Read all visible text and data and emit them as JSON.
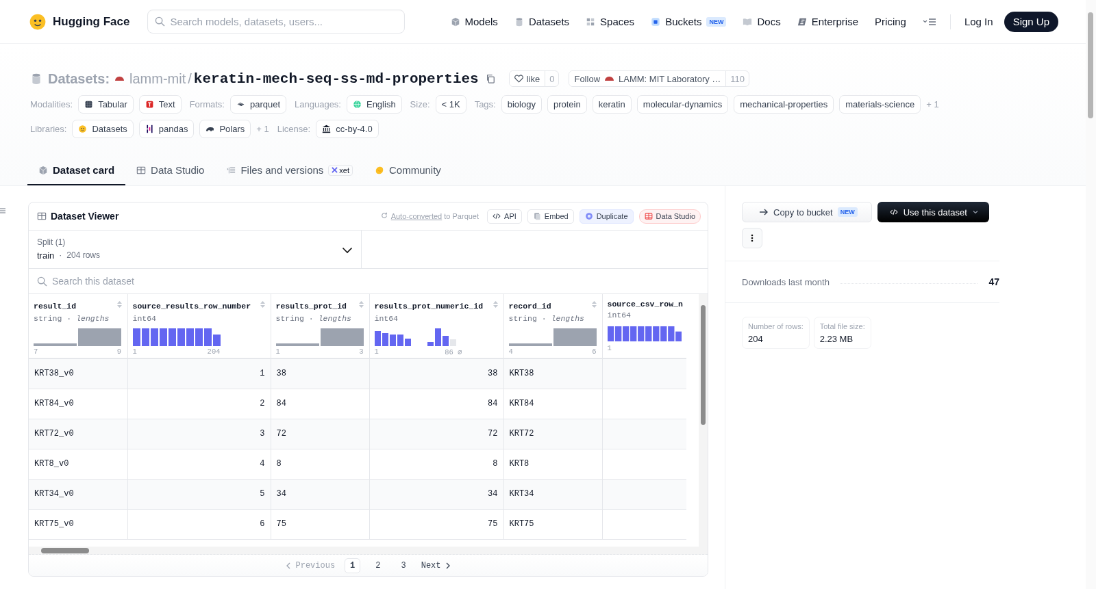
{
  "header": {
    "logo_text": "Hugging Face",
    "search": {
      "placeholder": "Search models, datasets, users..."
    },
    "nav": [
      {
        "label": "Models"
      },
      {
        "label": "Datasets"
      },
      {
        "label": "Spaces"
      },
      {
        "label": "Buckets",
        "badge": "NEW"
      },
      {
        "label": "Docs"
      },
      {
        "label": "Enterprise"
      },
      {
        "label": "Pricing"
      }
    ],
    "login": "Log In",
    "signup": "Sign Up"
  },
  "repo": {
    "type_label": "Datasets:",
    "owner": "lamm-mit",
    "separator": "/",
    "name": "keratin-mech-seq-ss-md-properties",
    "like": {
      "label": "like",
      "count": "0"
    },
    "follow": {
      "label": "Follow",
      "org": "LAMM: MIT Laboratory …",
      "count": "110"
    }
  },
  "meta_rows": [
    [
      {
        "label": "Modalities:",
        "chips": [
          "Tabular",
          "Text"
        ]
      },
      {
        "label": "Formats:",
        "chips": [
          "parquet"
        ]
      },
      {
        "label": "Languages:",
        "chips": [
          "English"
        ]
      },
      {
        "label": "Size:",
        "chips": [
          "< 1K"
        ]
      },
      {
        "label": "Tags:",
        "chips": [
          "biology",
          "protein",
          "keratin",
          "molecular-dynamics",
          "mechanical-properties",
          "materials-science"
        ],
        "more": "+ 1"
      }
    ],
    [
      {
        "label": "Libraries:",
        "chips": [
          "Datasets",
          "pandas",
          "Polars"
        ],
        "more": "+ 1"
      },
      {
        "label": "License:",
        "chips": [
          "cc-by-4.0"
        ]
      }
    ]
  ],
  "tabs": [
    {
      "label": "Dataset card",
      "selected": true
    },
    {
      "label": "Data Studio",
      "selected": false
    },
    {
      "label": "Files and versions",
      "selected": false,
      "badge": "xet"
    },
    {
      "label": "Community",
      "selected": false
    }
  ],
  "viewer": {
    "title": "Dataset Viewer",
    "converted_link": "Auto-converted",
    "converted_rest": "to Parquet",
    "actions": [
      {
        "label": "API",
        "kind": "code"
      },
      {
        "label": "Embed",
        "kind": "embed"
      },
      {
        "label": "Duplicate",
        "kind": "duplicate"
      },
      {
        "label": "Data Studio",
        "kind": "studio"
      }
    ],
    "split": {
      "label": "Split (1)",
      "name": "train",
      "dot": "·",
      "rows": "204 rows"
    },
    "search": {
      "placeholder": "Search this dataset"
    },
    "columns": [
      {
        "name": "result_id",
        "type": "string · *lengths*",
        "kind": "lengths",
        "min": "7",
        "max": "9"
      },
      {
        "name": "source_results_row_number",
        "type": "int64",
        "kind": "uniform",
        "min": "1",
        "max": "204"
      },
      {
        "name": "results_prot_id",
        "type": "string · *lengths*",
        "kind": "lengths",
        "min": "1",
        "max": "3"
      },
      {
        "name": "results_prot_numeric_id",
        "type": "int64",
        "kind": "bimodal",
        "min": "1",
        "max": "86 ∅"
      },
      {
        "name": "record_id",
        "type": "string · *lengths*",
        "kind": "lengths",
        "min": "4",
        "max": "6"
      },
      {
        "name": "source_csv_row_n",
        "type": "int64",
        "kind": "uniform",
        "min": "1"
      }
    ],
    "rows": [
      [
        "KRT38_v0",
        "1",
        "38",
        "38",
        "KRT38"
      ],
      [
        "KRT84_v0",
        "2",
        "84",
        "84",
        "KRT84"
      ],
      [
        "KRT72_v0",
        "3",
        "72",
        "72",
        "KRT72"
      ],
      [
        "KRT8_v0",
        "4",
        "8",
        "8",
        "KRT8"
      ],
      [
        "KRT34_v0",
        "5",
        "34",
        "34",
        "KRT34"
      ],
      [
        "KRT75_v0",
        "6",
        "75",
        "75",
        "KRT75"
      ]
    ],
    "pagination": {
      "previous": "Previous",
      "pages": [
        {
          "label": "1",
          "selected": true
        },
        {
          "label": "2",
          "selected": false
        },
        {
          "label": "3",
          "selected": false
        }
      ],
      "next": "Next"
    }
  },
  "sidebar": {
    "copy_button": {
      "label": "Copy to bucket",
      "badge": "NEW"
    },
    "use_button": "Use this dataset",
    "downloads": {
      "label": "Downloads last month",
      "value": "47"
    },
    "stats": [
      {
        "label": "Number of rows:",
        "value": "204"
      },
      {
        "label": "Total file size:",
        "value": "2.23 MB"
      }
    ]
  }
}
